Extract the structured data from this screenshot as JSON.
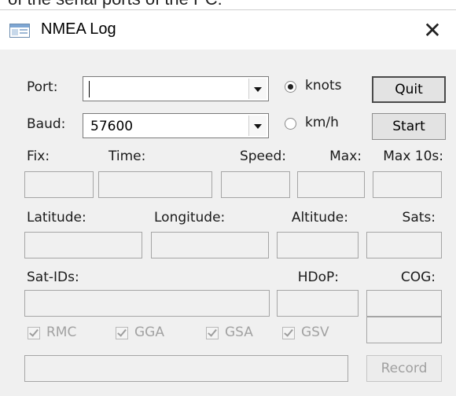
{
  "background_text": "of the serial ports of the PC:",
  "window": {
    "title": "NMEA Log",
    "close_glyph": "✕"
  },
  "port": {
    "label": "Port:",
    "value": ""
  },
  "baud": {
    "label": "Baud:",
    "value": "57600"
  },
  "units": {
    "knots": {
      "label": "knots",
      "selected": true
    },
    "kmh": {
      "label": "km/h",
      "selected": false
    }
  },
  "buttons": {
    "quit": "Quit",
    "start": "Start",
    "record": "Record"
  },
  "labels": {
    "fix": "Fix:",
    "time": "Time:",
    "speed": "Speed:",
    "max": "Max:",
    "max10s": "Max 10s:",
    "latitude": "Latitude:",
    "longitude": "Longitude:",
    "altitude": "Altitude:",
    "sats": "Sats:",
    "sat_ids": "Sat-IDs:",
    "hdop": "HDoP:",
    "cog": "COG:"
  },
  "checkboxes": [
    {
      "label": "RMC",
      "checked": true
    },
    {
      "label": "GGA",
      "checked": true
    },
    {
      "label": "GSA",
      "checked": true
    },
    {
      "label": "GSV",
      "checked": true
    }
  ]
}
